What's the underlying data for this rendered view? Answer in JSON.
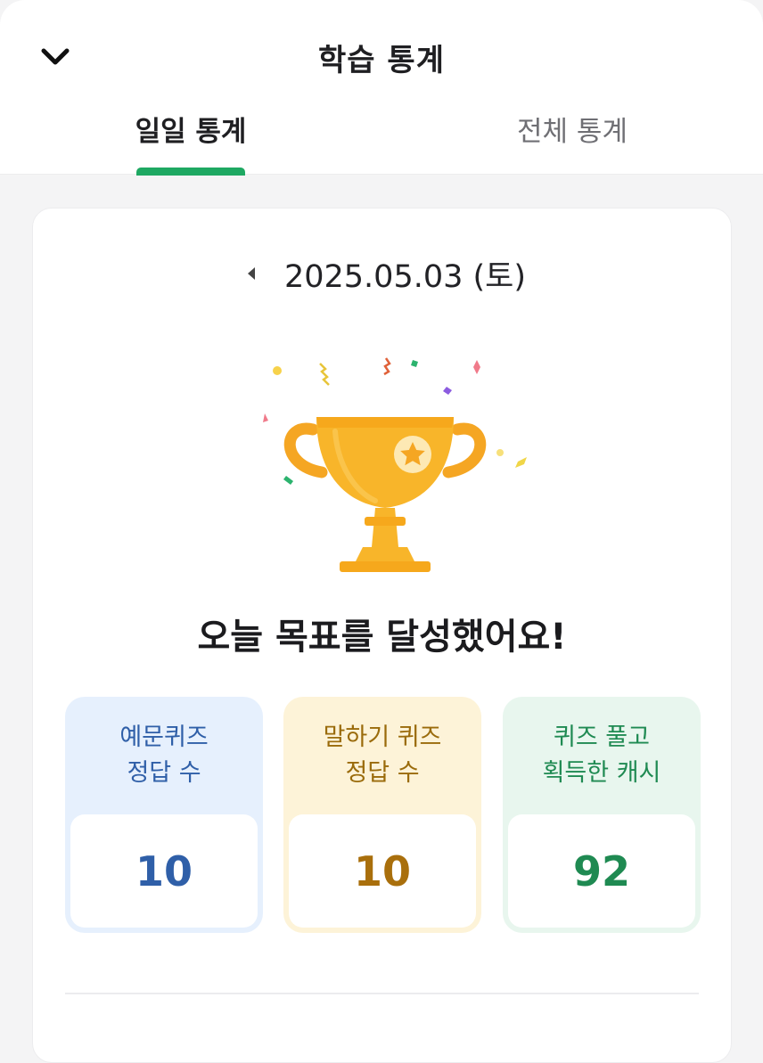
{
  "header": {
    "title": "학습 통계",
    "back_icon": "chevron-down-icon"
  },
  "tabs": [
    {
      "label": "일일 통계",
      "active": true
    },
    {
      "label": "전체 통계",
      "active": false
    }
  ],
  "date_nav": {
    "date": "2025.05.03 (토)",
    "prev_icon": "caret-left-icon"
  },
  "achievement": {
    "icon": "trophy-icon",
    "message": "오늘 목표를 달성했어요!"
  },
  "stats": [
    {
      "line1": "예문퀴즈",
      "line2": "정답 수",
      "value": "10"
    },
    {
      "line1": "말하기 퀴즈",
      "line2": "정답 수",
      "value": "10"
    },
    {
      "line1": "퀴즈 풀고",
      "line2": "획득한 캐시",
      "value": "92"
    }
  ],
  "colors": {
    "accent_green": "#1ea862",
    "trophy_gold": "#f8b52a",
    "stat_blue": "#2f5fa8",
    "stat_gold": "#a96f0c",
    "stat_green": "#1f8a52"
  }
}
